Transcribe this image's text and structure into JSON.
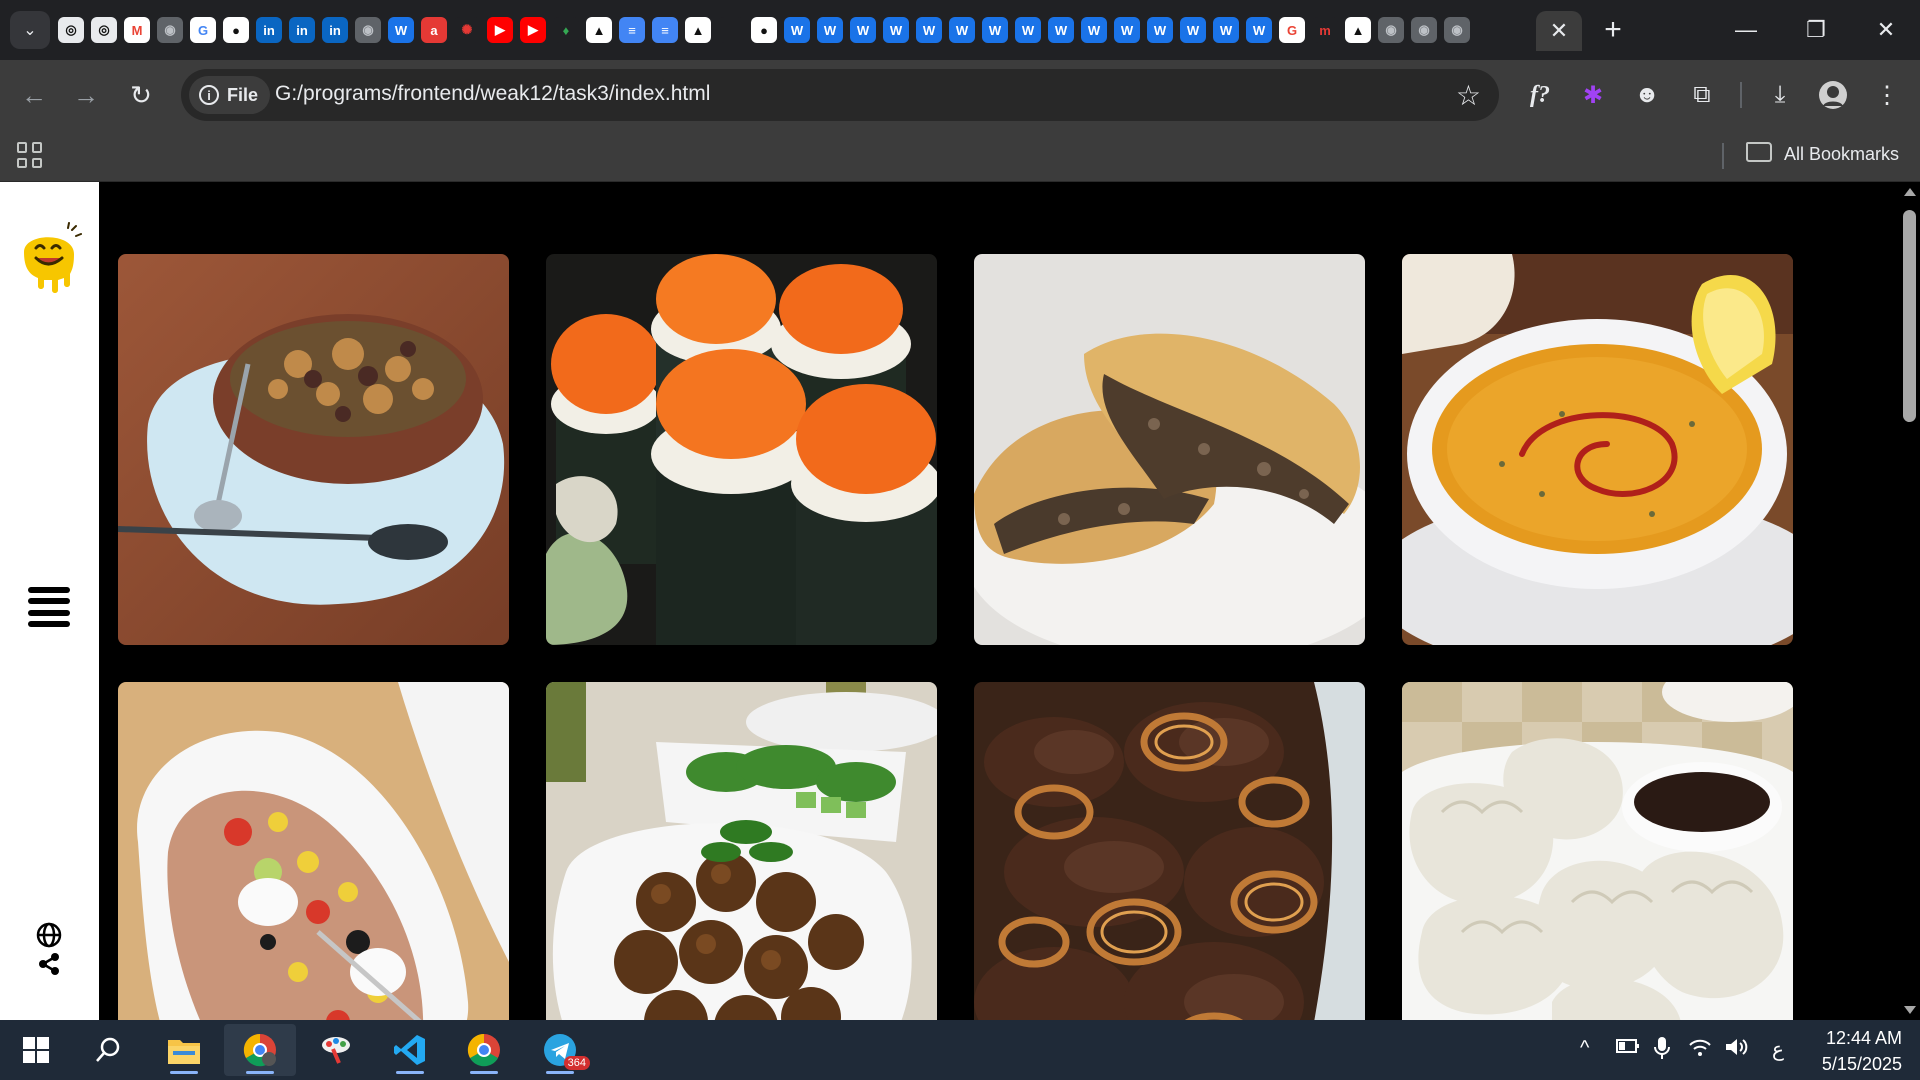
{
  "browser": {
    "tabs": {
      "favicons": [
        {
          "name": "openai-icon",
          "glyph": "◎",
          "bg": "#e8eaed",
          "fg": "#111"
        },
        {
          "name": "openai-icon",
          "glyph": "◎",
          "bg": "#e8eaed",
          "fg": "#111"
        },
        {
          "name": "gmail-icon",
          "glyph": "M",
          "bg": "#ffffff",
          "fg": "#ea4335"
        },
        {
          "name": "globe-icon",
          "glyph": "◉",
          "bg": "#5f6368",
          "fg": "#bdc1c6"
        },
        {
          "name": "google-icon",
          "glyph": "G",
          "bg": "#ffffff",
          "fg": "#4285f4"
        },
        {
          "name": "github-icon",
          "glyph": "●",
          "bg": "#ffffff",
          "fg": "#111"
        },
        {
          "name": "linkedin-icon",
          "glyph": "in",
          "bg": "#0a66c2",
          "fg": "#fff"
        },
        {
          "name": "linkedin-icon",
          "glyph": "in",
          "bg": "#0a66c2",
          "fg": "#fff"
        },
        {
          "name": "linkedin-icon",
          "glyph": "in",
          "bg": "#0a66c2",
          "fg": "#fff"
        },
        {
          "name": "globe-icon",
          "glyph": "◉",
          "bg": "#5f6368",
          "fg": "#bdc1c6"
        },
        {
          "name": "w-icon",
          "glyph": "W",
          "bg": "#1a73e8",
          "fg": "#fff"
        },
        {
          "name": "a-icon",
          "glyph": "a",
          "bg": "#e53935",
          "fg": "#fff"
        },
        {
          "name": "octopus-icon",
          "glyph": "✺",
          "bg": "#202124",
          "fg": "#e53935"
        },
        {
          "name": "youtube-icon",
          "glyph": "▶",
          "bg": "#ff0000",
          "fg": "#fff"
        },
        {
          "name": "youtube-icon",
          "glyph": "▶",
          "bg": "#ff0000",
          "fg": "#fff"
        },
        {
          "name": "leaf-icon",
          "glyph": "♦",
          "bg": "#202124",
          "fg": "#34a853"
        },
        {
          "name": "triangle-icon",
          "glyph": "▲",
          "bg": "#ffffff",
          "fg": "#111"
        },
        {
          "name": "docs-icon",
          "glyph": "≡",
          "bg": "#4285f4",
          "fg": "#fff"
        },
        {
          "name": "docs-icon",
          "glyph": "≡",
          "bg": "#4285f4",
          "fg": "#fff"
        },
        {
          "name": "triangle-icon",
          "glyph": "▲",
          "bg": "#ffffff",
          "fg": "#111"
        },
        {
          "name": "blank-icon",
          "glyph": "",
          "bg": "#202124",
          "fg": "#fff"
        },
        {
          "name": "github-icon",
          "glyph": "●",
          "bg": "#ffffff",
          "fg": "#111"
        },
        {
          "name": "w-icon",
          "glyph": "W",
          "bg": "#1a73e8",
          "fg": "#fff"
        },
        {
          "name": "w-icon",
          "glyph": "W",
          "bg": "#1a73e8",
          "fg": "#fff"
        },
        {
          "name": "w-icon",
          "glyph": "W",
          "bg": "#1a73e8",
          "fg": "#fff"
        },
        {
          "name": "w-icon",
          "glyph": "W",
          "bg": "#1a73e8",
          "fg": "#fff"
        },
        {
          "name": "w-icon",
          "glyph": "W",
          "bg": "#1a73e8",
          "fg": "#fff"
        },
        {
          "name": "w-icon",
          "glyph": "W",
          "bg": "#1a73e8",
          "fg": "#fff"
        },
        {
          "name": "w-icon",
          "glyph": "W",
          "bg": "#1a73e8",
          "fg": "#fff"
        },
        {
          "name": "w-icon",
          "glyph": "W",
          "bg": "#1a73e8",
          "fg": "#fff"
        },
        {
          "name": "w-icon",
          "glyph": "W",
          "bg": "#1a73e8",
          "fg": "#fff"
        },
        {
          "name": "w-icon",
          "glyph": "W",
          "bg": "#1a73e8",
          "fg": "#fff"
        },
        {
          "name": "w-icon",
          "glyph": "W",
          "bg": "#1a73e8",
          "fg": "#fff"
        },
        {
          "name": "w-icon",
          "glyph": "W",
          "bg": "#1a73e8",
          "fg": "#fff"
        },
        {
          "name": "w-icon",
          "glyph": "W",
          "bg": "#1a73e8",
          "fg": "#fff"
        },
        {
          "name": "w-icon",
          "glyph": "W",
          "bg": "#1a73e8",
          "fg": "#fff"
        },
        {
          "name": "w-icon",
          "glyph": "W",
          "bg": "#1a73e8",
          "fg": "#fff"
        },
        {
          "name": "google-icon",
          "glyph": "G",
          "bg": "#ffffff",
          "fg": "#ea4335"
        },
        {
          "name": "m-icon",
          "glyph": "m",
          "bg": "#202124",
          "fg": "#e53935"
        },
        {
          "name": "triangle-icon",
          "glyph": "▲",
          "bg": "#ffffff",
          "fg": "#111"
        },
        {
          "name": "globe-icon",
          "glyph": "◉",
          "bg": "#5f6368",
          "fg": "#bdc1c6"
        },
        {
          "name": "globe-icon",
          "glyph": "◉",
          "bg": "#5f6368",
          "fg": "#bdc1c6"
        },
        {
          "name": "globe-icon",
          "glyph": "◉",
          "bg": "#5f6368",
          "fg": "#bdc1c6"
        }
      ],
      "close_glyph": "✕",
      "new_tab_glyph": "+",
      "search_glyph": "⌄"
    },
    "window": {
      "minimize": "—",
      "restore": "❐",
      "close": "✕"
    },
    "toolbar": {
      "back": "←",
      "forward": "→",
      "reload": "↻",
      "chip_label": "File",
      "chip_icon": "i",
      "url": "G:/programs/frontend/weak12/task3/index.html",
      "star": "☆",
      "ext_font": "f?",
      "ext_gear": "✱",
      "ext_face": "☻",
      "ext_puzzle": "⧉",
      "download": "⤓",
      "menu": "⋮"
    },
    "bookmarks": {
      "all_bookmarks_label": "All Bookmarks"
    }
  },
  "page": {
    "accent_color": "#f7c600",
    "gallery": [
      {
        "name": "stew-bowl-card"
      },
      {
        "name": "sushi-rolls-card"
      },
      {
        "name": "meat-pie-card"
      },
      {
        "name": "lentil-soup-card"
      },
      {
        "name": "baked-potato-card"
      },
      {
        "name": "falafel-card"
      },
      {
        "name": "liver-onions-card"
      },
      {
        "name": "dumplings-card"
      }
    ]
  },
  "taskbar": {
    "time": "12:44 AM",
    "date": "5/15/2025",
    "telegram_badge": "364",
    "tray_chevron": "^",
    "tray_lang": "ع"
  }
}
